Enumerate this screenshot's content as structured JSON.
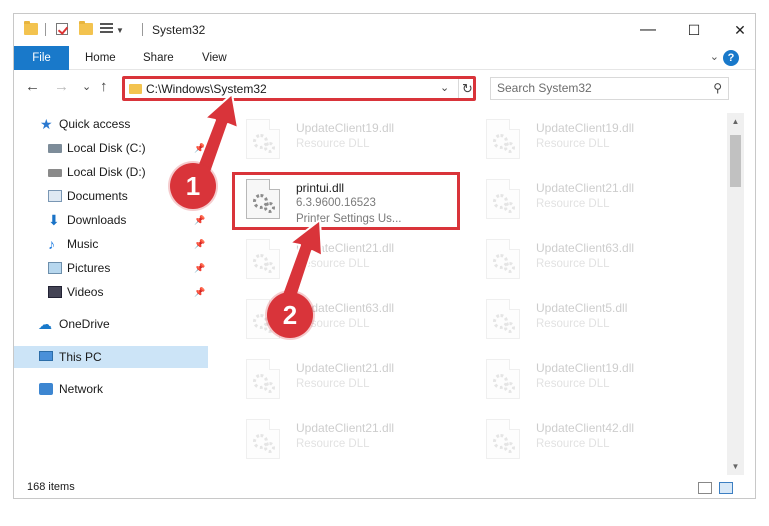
{
  "window": {
    "title": "System32",
    "controls": {
      "minimize": "—",
      "maximize": "☐",
      "close": "✕"
    }
  },
  "ribbon": {
    "tabs": [
      "File",
      "Home",
      "Share",
      "View"
    ],
    "collapse_glyph": "⌄",
    "help_glyph": "?"
  },
  "nav": {
    "back": "←",
    "forward": "→",
    "recent": "⌄",
    "up": "↑",
    "address": "C:\\Windows\\System32",
    "dropdown": "⌄",
    "refresh": "↻",
    "search_placeholder": "Search System32",
    "search_glyph": "⚲"
  },
  "sidebar": {
    "items": [
      {
        "label": "Quick access",
        "icon": "star-icon"
      },
      {
        "label": "Local Disk (C:)",
        "icon": "drive-icon",
        "pinned": true
      },
      {
        "label": "Local Disk (D:)",
        "icon": "drive-icon"
      },
      {
        "label": "Documents",
        "icon": "documents-icon"
      },
      {
        "label": "Downloads",
        "icon": "download-icon",
        "pinned": true
      },
      {
        "label": "Music",
        "icon": "music-icon",
        "pinned": true
      },
      {
        "label": "Pictures",
        "icon": "pictures-icon",
        "pinned": true
      },
      {
        "label": "Videos",
        "icon": "videos-icon",
        "pinned": true
      },
      {
        "label": "OneDrive",
        "icon": "cloud-icon"
      },
      {
        "label": "This PC",
        "icon": "computer-icon",
        "selected": true
      },
      {
        "label": "Network",
        "icon": "network-icon"
      }
    ],
    "pin_glyph": "📌"
  },
  "files": {
    "left": [
      {
        "name": "UpdateClient19.dll",
        "type": "Resource DLL"
      },
      {
        "name": "printui.dll",
        "version": "6.3.9600.16523",
        "description": "Printer Settings Us..."
      },
      {
        "name": "UpdateClient21.dll",
        "type": "Resource DLL"
      },
      {
        "name": "UpdateClient63.dll",
        "type": "Resource DLL"
      },
      {
        "name": "UpdateClient21.dll",
        "type": "Resource DLL"
      },
      {
        "name": "UpdateClient21.dll",
        "type": "Resource DLL"
      }
    ],
    "right": [
      {
        "name": "UpdateClient19.dll",
        "type": "Resource DLL"
      },
      {
        "name": "UpdateClient21.dll",
        "type": "Resource DLL"
      },
      {
        "name": "UpdateClient63.dll",
        "type": "Resource DLL"
      },
      {
        "name": "UpdateClient5.dll",
        "type": "Resource DLL"
      },
      {
        "name": "UpdateClient19.dll",
        "type": "Resource DLL"
      },
      {
        "name": "UpdateClient42.dll",
        "type": "Resource DLL"
      }
    ]
  },
  "status": {
    "item_count": "168 items"
  },
  "annotations": {
    "step1": "1",
    "step2": "2",
    "accent": "#d9343a"
  }
}
